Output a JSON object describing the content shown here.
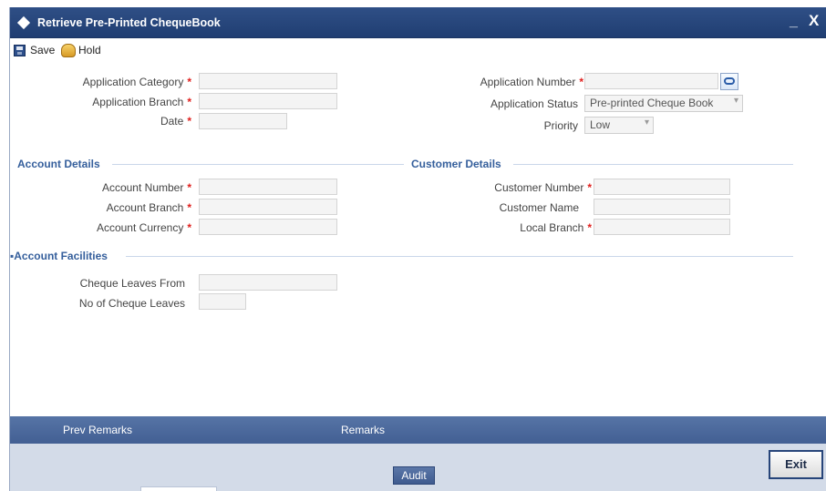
{
  "window": {
    "title": "Retrieve Pre-Printed ChequeBook",
    "minimize": "_",
    "close": "X"
  },
  "toolbar": {
    "save_label": "Save",
    "hold_label": "Hold"
  },
  "header": {
    "application_category": {
      "label": "Application Category",
      "value": ""
    },
    "application_branch": {
      "label": "Application Branch",
      "value": ""
    },
    "date": {
      "label": "Date",
      "value": ""
    },
    "application_number": {
      "label": "Application Number",
      "value": ""
    },
    "application_status": {
      "label": "Application Status",
      "value": "Pre-printed Cheque Book"
    },
    "priority": {
      "label": "Priority",
      "value": "Low"
    },
    "required_marker": "*"
  },
  "account_details": {
    "title": "Account Details",
    "account_number": {
      "label": "Account Number",
      "value": ""
    },
    "account_branch": {
      "label": "Account Branch",
      "value": ""
    },
    "account_currency": {
      "label": "Account Currency",
      "value": ""
    }
  },
  "customer_details": {
    "title": "Customer Details",
    "customer_number": {
      "label": "Customer Number",
      "value": ""
    },
    "customer_name": {
      "label": "Customer Name",
      "value": ""
    },
    "local_branch": {
      "label": "Local Branch",
      "value": ""
    }
  },
  "account_facilities": {
    "title": "Account Facilities",
    "cheque_leaves_from": {
      "label": "Cheque Leaves From",
      "value": ""
    },
    "no_of_cheque_leaves": {
      "label": "No of Cheque Leaves",
      "value": ""
    }
  },
  "footer": {
    "prev_remarks": "Prev Remarks",
    "remarks": "Remarks",
    "audit": "Audit",
    "exit": "Exit"
  },
  "icons": {
    "window": "diamond-icon",
    "save": "save-icon",
    "hold": "hold-icon",
    "lookup": "lookup-icon",
    "dropdown": "chevron-down-icon"
  },
  "colors": {
    "title_bar": "#203e72",
    "section_title": "#355f9c",
    "required": "#e0201e",
    "footer_band": "#4a679b"
  }
}
